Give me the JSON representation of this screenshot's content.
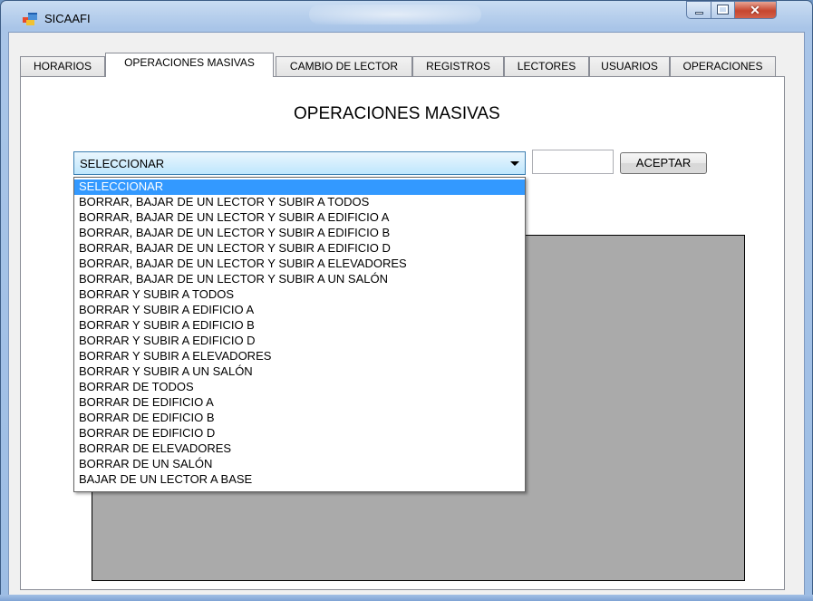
{
  "window": {
    "title": "SICAAFI",
    "close_glyph": "✕"
  },
  "tabs": [
    {
      "label": "HORARIOS"
    },
    {
      "label": "OPERACIONES MASIVAS",
      "active": true
    },
    {
      "label": "CAMBIO DE LECTOR"
    },
    {
      "label": "REGISTROS"
    },
    {
      "label": "LECTORES"
    },
    {
      "label": "USUARIOS"
    },
    {
      "label": "OPERACIONES"
    }
  ],
  "main": {
    "heading": "OPERACIONES MASIVAS",
    "combo_value": "SELECCIONAR",
    "text_value": "",
    "accept_label": "ACEPTAR"
  },
  "dropdown": {
    "selected_index": 0,
    "options": [
      "SELECCIONAR",
      "BORRAR, BAJAR DE UN LECTOR Y SUBIR A TODOS",
      "BORRAR, BAJAR DE UN LECTOR Y SUBIR A EDIFICIO A",
      "BORRAR, BAJAR DE UN LECTOR Y SUBIR A EDIFICIO B",
      "BORRAR, BAJAR DE UN LECTOR Y SUBIR A EDIFICIO D",
      "BORRAR, BAJAR DE UN LECTOR Y SUBIR A ELEVADORES",
      "BORRAR, BAJAR DE UN LECTOR Y SUBIR A UN SALÓN",
      "BORRAR Y SUBIR A TODOS",
      "BORRAR Y SUBIR A EDIFICIO A",
      "BORRAR Y SUBIR A EDIFICIO B",
      "BORRAR Y SUBIR A EDIFICIO D",
      "BORRAR Y SUBIR A ELEVADORES",
      "BORRAR Y SUBIR A UN SALÓN",
      "BORRAR DE TODOS",
      "BORRAR DE EDIFICIO A",
      "BORRAR DE EDIFICIO B",
      "BORRAR DE EDIFICIO D",
      "BORRAR DE ELEVADORES",
      "BORRAR DE UN SALÓN",
      "BAJAR DE UN LECTOR A BASE"
    ]
  },
  "icons": {
    "app": "app-window-icon",
    "minimize": "minimize-icon",
    "maximize": "maximize-icon",
    "close": "close-icon",
    "dropdown": "chevron-down-icon"
  },
  "colors": {
    "selection": "#3399ff",
    "panel_gray": "#aaaaaa",
    "close_red": "#c7462f"
  }
}
